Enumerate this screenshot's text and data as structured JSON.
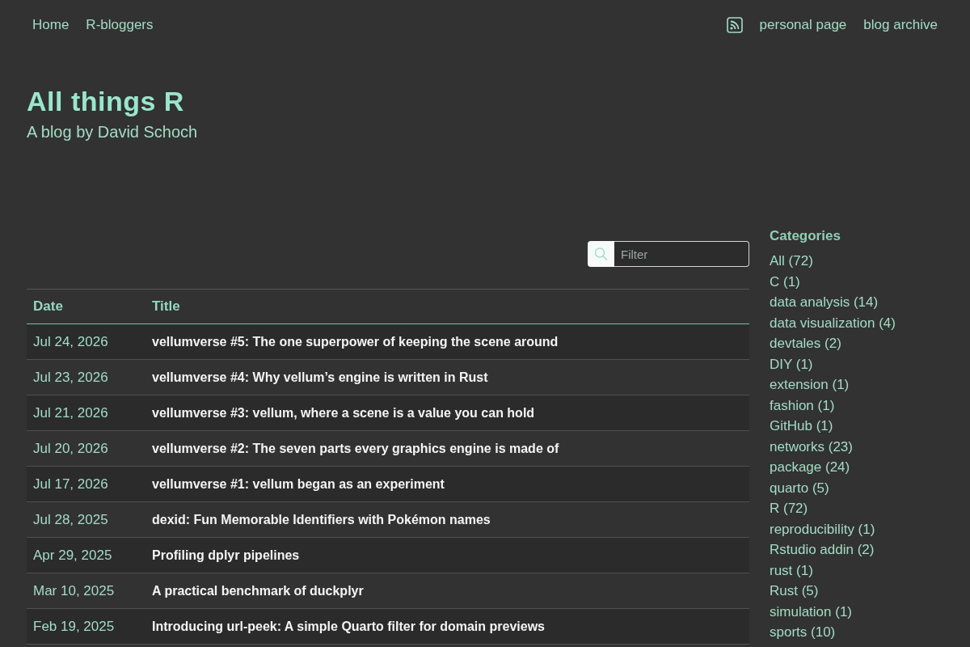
{
  "nav": {
    "left_links": [
      "Home",
      "R-bloggers"
    ],
    "right_links": [
      "personal page",
      "blog archive"
    ]
  },
  "header": {
    "title": "All things R",
    "subtitle": "A blog by David Schoch"
  },
  "filter": {
    "placeholder": "Filter"
  },
  "table": {
    "columns": [
      "Date",
      "Title"
    ],
    "rows": [
      {
        "date": "Jul 24, 2026",
        "title": "vellumverse #5: The one superpower of keeping the scene around"
      },
      {
        "date": "Jul 23, 2026",
        "title": "vellumverse #4: Why vellum’s engine is written in Rust"
      },
      {
        "date": "Jul 21, 2026",
        "title": "vellumverse #3: vellum, where a scene is a value you can hold"
      },
      {
        "date": "Jul 20, 2026",
        "title": "vellumverse #2: The seven parts every graphics engine is made of"
      },
      {
        "date": "Jul 17, 2026",
        "title": "vellumverse #1: vellum began as an experiment"
      },
      {
        "date": "Jul 28, 2025",
        "title": "dexid: Fun Memorable Identifiers with Pokémon names"
      },
      {
        "date": "Apr 29, 2025",
        "title": "Profiling dplyr pipelines"
      },
      {
        "date": "Mar 10, 2025",
        "title": "A practical benchmark of duckplyr"
      },
      {
        "date": "Feb 19, 2025",
        "title": "Introducing url-peek: A simple Quarto filter for domain previews"
      }
    ]
  },
  "categories": {
    "title": "Categories",
    "items": [
      "All (72)",
      "C (1)",
      "data analysis (14)",
      "data visualization (4)",
      "devtales (2)",
      "DIY (1)",
      "extension (1)",
      "fashion (1)",
      "GitHub (1)",
      "networks (23)",
      "package (24)",
      "quarto (5)",
      "R (72)",
      "reproducibility (1)",
      "Rstudio addin (2)",
      "rust (1)",
      "Rust (5)",
      "simulation (1)",
      "sports (10)"
    ]
  }
}
